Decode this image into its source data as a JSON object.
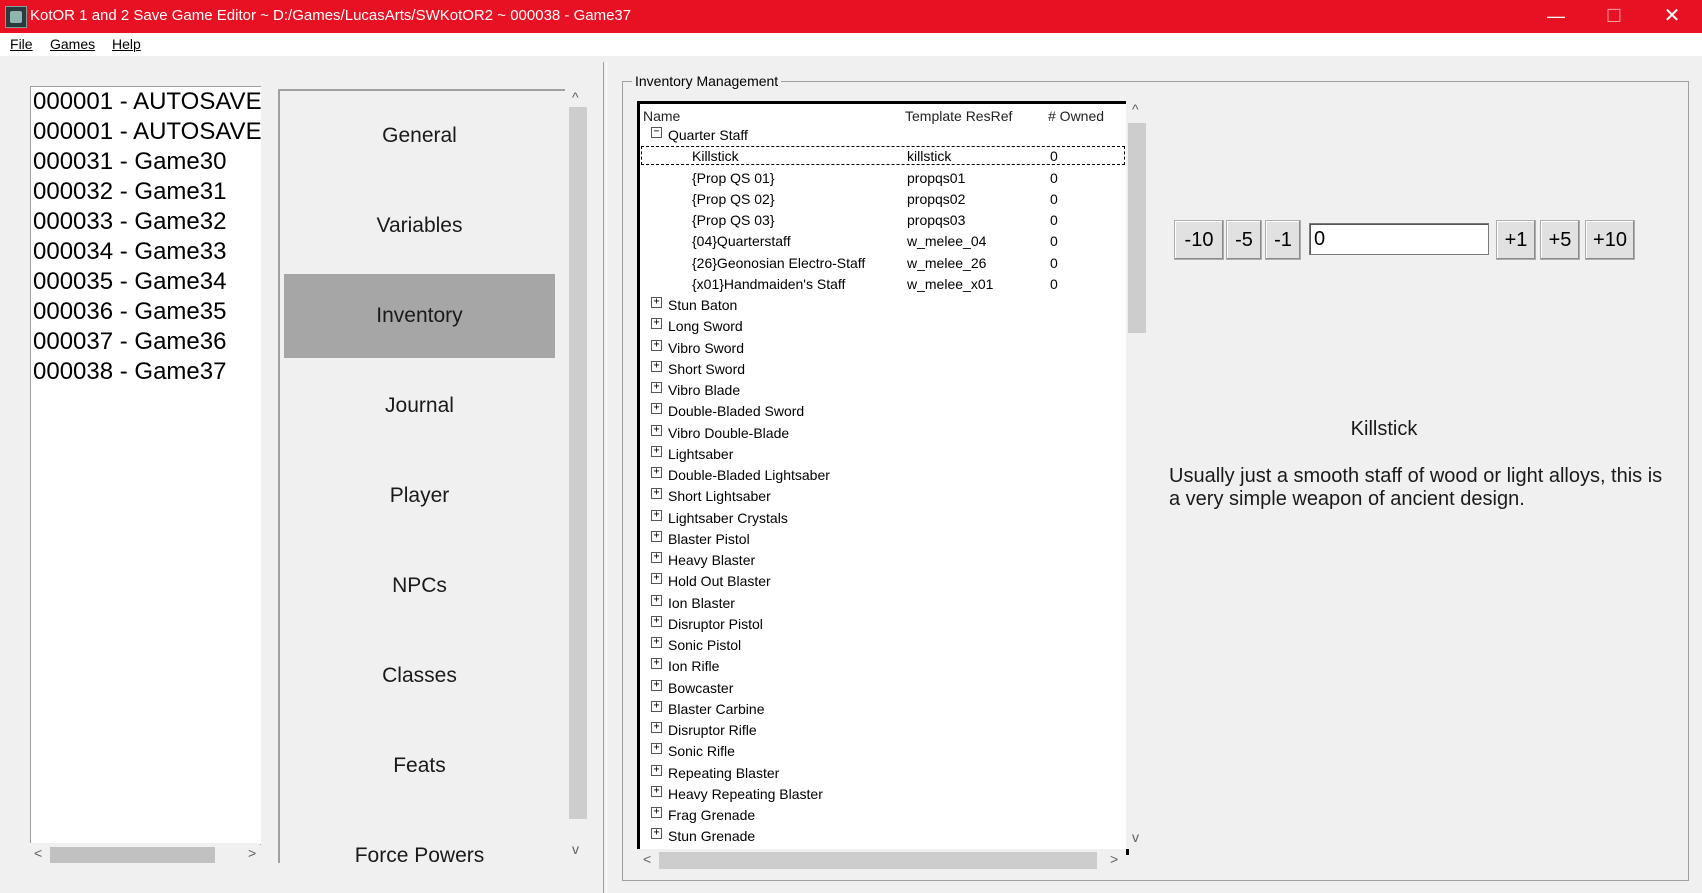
{
  "window": {
    "title": "KotOR 1 and 2 Save Game Editor ~ D:/Games/LucasArts/SWKotOR2 ~ 000038 - Game37",
    "minimize": "—",
    "maximize": "☐",
    "close": "✕",
    "titlebar_color": "#e81123"
  },
  "menu": {
    "file": "File",
    "games": "Games",
    "help": "Help"
  },
  "saves": [
    "000001 - AUTOSAVE",
    "000001 - AUTOSAVE",
    "000031 - Game30",
    "000032 - Game31",
    "000033 - Game32",
    "000034 - Game33",
    "000035 - Game34",
    "000036 - Game35",
    "000037 - Game36",
    "000038 - Game37"
  ],
  "nav": [
    {
      "label": "General",
      "active": false
    },
    {
      "label": "Variables",
      "active": false
    },
    {
      "label": "Inventory",
      "active": true
    },
    {
      "label": "Journal",
      "active": false
    },
    {
      "label": "Player",
      "active": false
    },
    {
      "label": "NPCs",
      "active": false
    },
    {
      "label": "Classes",
      "active": false
    },
    {
      "label": "Feats",
      "active": false
    },
    {
      "label": "Force Powers",
      "active": false
    }
  ],
  "inventory": {
    "group_label": "Inventory Management",
    "columns": {
      "name": "Name",
      "resref": "Template ResRef",
      "owned": "# Owned"
    },
    "rows": [
      {
        "type": "group",
        "name": "Quarter Staff",
        "expanded": true
      },
      {
        "type": "item",
        "name": "Killstick",
        "resref": "killstick",
        "owned": "0",
        "selected": true
      },
      {
        "type": "item",
        "name": "{Prop QS 01}",
        "resref": "propqs01",
        "owned": "0"
      },
      {
        "type": "item",
        "name": "{Prop QS 02}",
        "resref": "propqs02",
        "owned": "0"
      },
      {
        "type": "item",
        "name": "{Prop QS 03}",
        "resref": "propqs03",
        "owned": "0"
      },
      {
        "type": "item",
        "name": "{04}Quarterstaff",
        "resref": "w_melee_04",
        "owned": "0"
      },
      {
        "type": "item",
        "name": "{26}Geonosian Electro-Staff",
        "resref": "w_melee_26",
        "owned": "0"
      },
      {
        "type": "item",
        "name": "{x01}Handmaiden's Staff",
        "resref": "w_melee_x01",
        "owned": "0"
      },
      {
        "type": "group",
        "name": "Stun Baton"
      },
      {
        "type": "group",
        "name": "Long Sword"
      },
      {
        "type": "group",
        "name": "Vibro Sword"
      },
      {
        "type": "group",
        "name": "Short Sword"
      },
      {
        "type": "group",
        "name": "Vibro Blade"
      },
      {
        "type": "group",
        "name": "Double-Bladed Sword"
      },
      {
        "type": "group",
        "name": "Vibro Double-Blade"
      },
      {
        "type": "group",
        "name": "Lightsaber"
      },
      {
        "type": "group",
        "name": "Double-Bladed Lightsaber"
      },
      {
        "type": "group",
        "name": "Short Lightsaber"
      },
      {
        "type": "group",
        "name": "Lightsaber Crystals"
      },
      {
        "type": "group",
        "name": "Blaster Pistol"
      },
      {
        "type": "group",
        "name": "Heavy Blaster"
      },
      {
        "type": "group",
        "name": "Hold Out Blaster"
      },
      {
        "type": "group",
        "name": "Ion Blaster"
      },
      {
        "type": "group",
        "name": "Disruptor Pistol"
      },
      {
        "type": "group",
        "name": "Sonic Pistol"
      },
      {
        "type": "group",
        "name": "Ion Rifle"
      },
      {
        "type": "group",
        "name": "Bowcaster"
      },
      {
        "type": "group",
        "name": "Blaster Carbine"
      },
      {
        "type": "group",
        "name": "Disruptor Rifle"
      },
      {
        "type": "group",
        "name": "Sonic Rifle"
      },
      {
        "type": "group",
        "name": "Repeating Blaster"
      },
      {
        "type": "group",
        "name": "Heavy Repeating Blaster"
      },
      {
        "type": "group",
        "name": "Frag Grenade"
      },
      {
        "type": "group",
        "name": "Stun Grenade"
      }
    ],
    "quantity_buttons": [
      "-10",
      "-5",
      "-1",
      "+1",
      "+5",
      "+10"
    ],
    "quantity_value": "0",
    "selected_name": "Killstick",
    "selected_description": "Usually just a smooth staff of wood or light alloys, this is a very simple weapon of ancient design."
  }
}
